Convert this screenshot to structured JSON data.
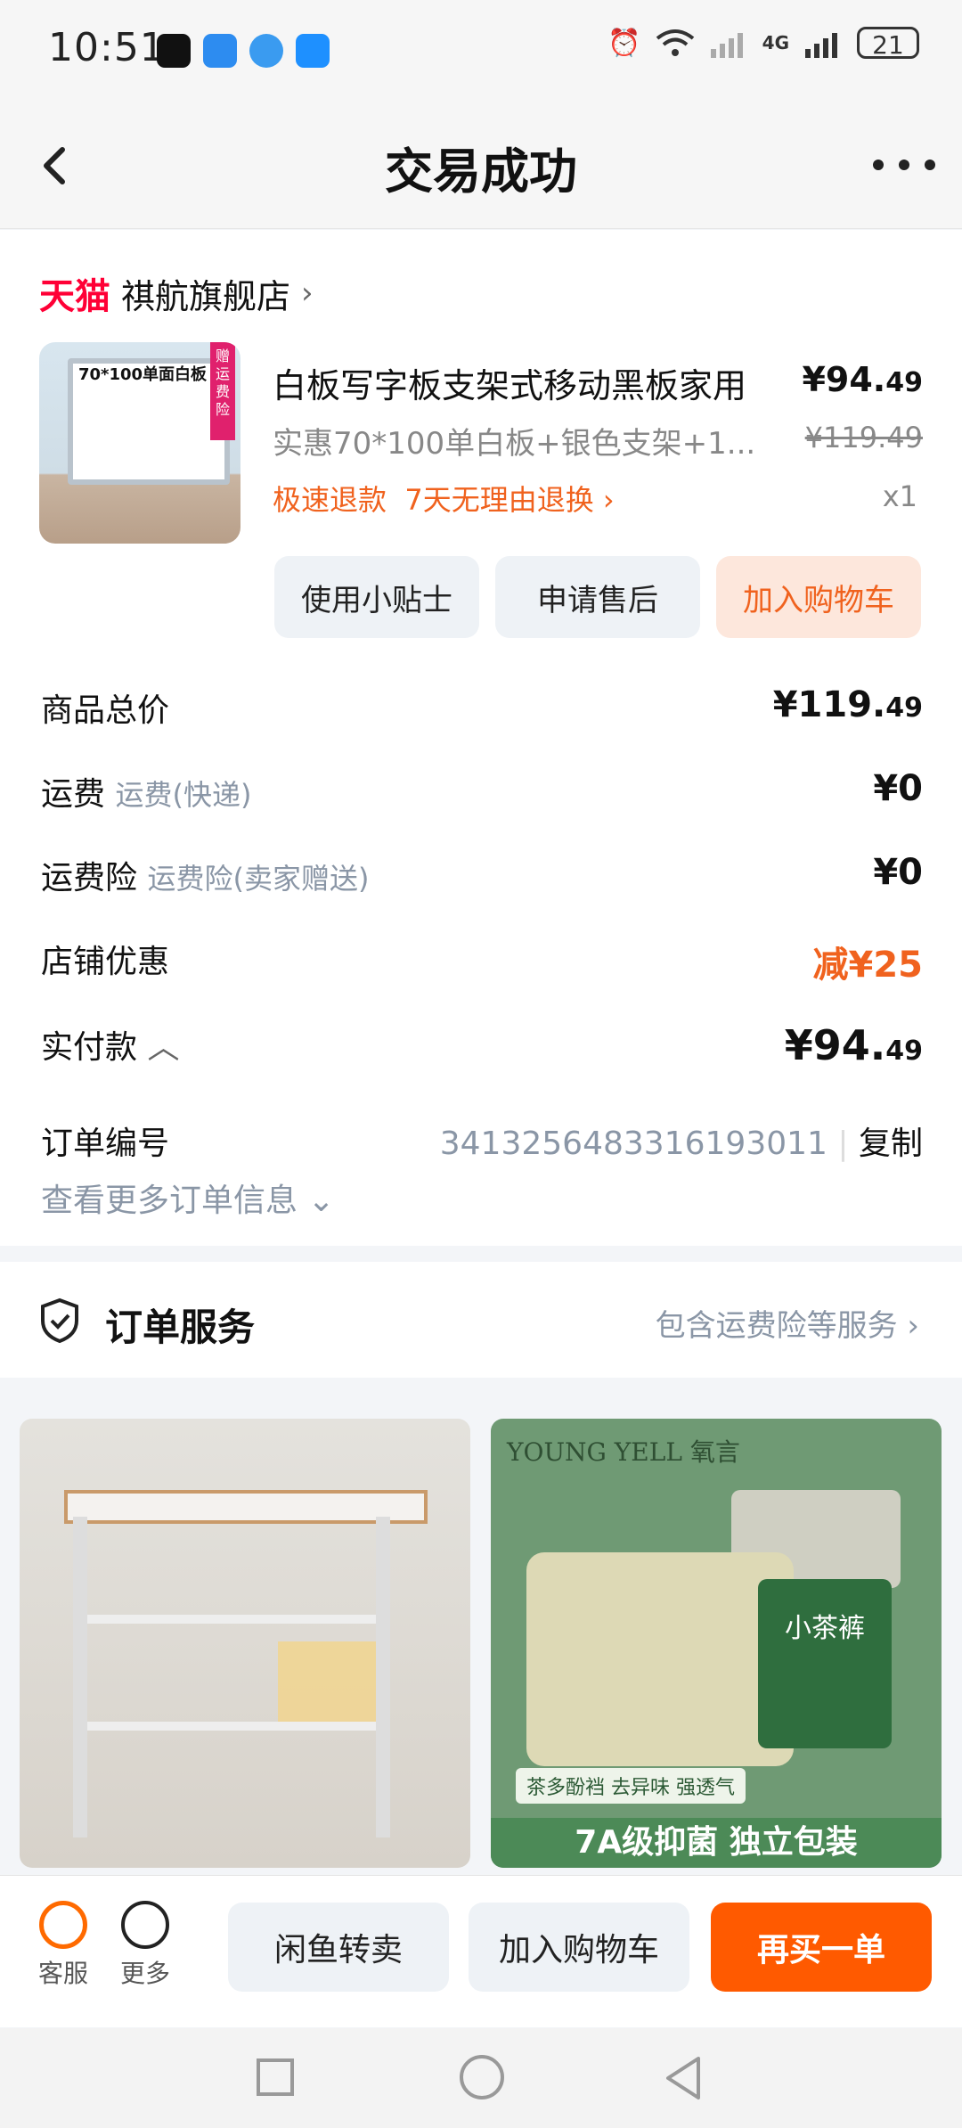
{
  "status_bar": {
    "time": "10:51",
    "battery": "21",
    "network": "4G"
  },
  "header": {
    "title": "交易成功"
  },
  "store": {
    "platform": "天猫",
    "name": "祺航旗舰店"
  },
  "product": {
    "name": "白板写字板支架式移动黑板家用",
    "price_int": "¥94.",
    "price_dec": "49",
    "spec": "实惠70*100单白板+银色支架+1...",
    "orig_price": "¥119.49",
    "refund": "极速退款",
    "return_policy": "7天无理由退换",
    "qty": "x1",
    "thumb_title": "70*100单面白板",
    "thumb_tag": "赠运费险"
  },
  "product_actions": {
    "note": "使用小贴士",
    "after_sale": "申请售后",
    "add_cart": "加入购物车"
  },
  "summary": {
    "total_label": "商品总价",
    "total_int": "¥119.",
    "total_dec": "49",
    "shipping_label": "运费",
    "shipping_sub": "运费(快递)",
    "shipping_val": "¥0",
    "insurance_label": "运费险",
    "insurance_sub": "运费险(卖家赠送)",
    "insurance_val": "¥0",
    "discount_label": "店铺优惠",
    "discount_val": "减¥25",
    "paid_label": "实付款",
    "paid_int": "¥94.",
    "paid_dec": "49",
    "order_label": "订单编号",
    "order_no": "3413256483316193011",
    "copy": "复制",
    "more_info": "查看更多订单信息"
  },
  "service": {
    "title": "订单服务",
    "right": "包含运费险等服务"
  },
  "recommendations": {
    "rec2_brand": "YOUNG YELL 氧言",
    "rec2_pack": "小茶裤",
    "rec2_tag": "茶多酚裆 去异味 强透气",
    "rec2_bottom": "7A级抑菌 独立包装"
  },
  "bottom_bar": {
    "kefu": "客服",
    "more": "更多",
    "resell": "闲鱼转卖",
    "add_cart": "加入购物车",
    "rebuy": "再买一单"
  }
}
